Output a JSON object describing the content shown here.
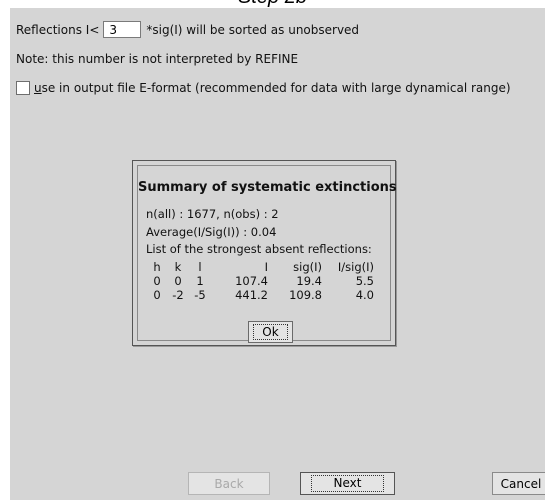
{
  "step_title": "Step 2b",
  "options": {
    "reflections_prefix": "Reflections I<",
    "threshold_value": "3",
    "reflections_suffix": "*sig(I) will be sorted as unobserved",
    "note": "Note: this number is not interpreted by REFINE",
    "eformat_mnemonic": "u",
    "eformat_label": "se in output file E-format (recommended for data with large dynamical range)",
    "eformat_checked": false
  },
  "dialog": {
    "title": "Summary of systematic extinctions",
    "n_line": "n(all) :  1677, n(obs) :    2",
    "avg_line": "Average(I/Sig(I)) : 0.04",
    "list_line": "List of the strongest absent reflections:",
    "columns": [
      "h",
      "k",
      "l",
      "I",
      "sig(I)",
      "I/sig(I)"
    ],
    "rows": [
      [
        "0",
        "0",
        "1",
        "107.4",
        "19.4",
        "5.5"
      ],
      [
        "0",
        "-2",
        "-5",
        "441.2",
        "109.8",
        "4.0"
      ]
    ],
    "ok_label": "Ok"
  },
  "footer": {
    "back_label": "Back",
    "next_label": "Next",
    "cancel_label": "Cancel"
  }
}
